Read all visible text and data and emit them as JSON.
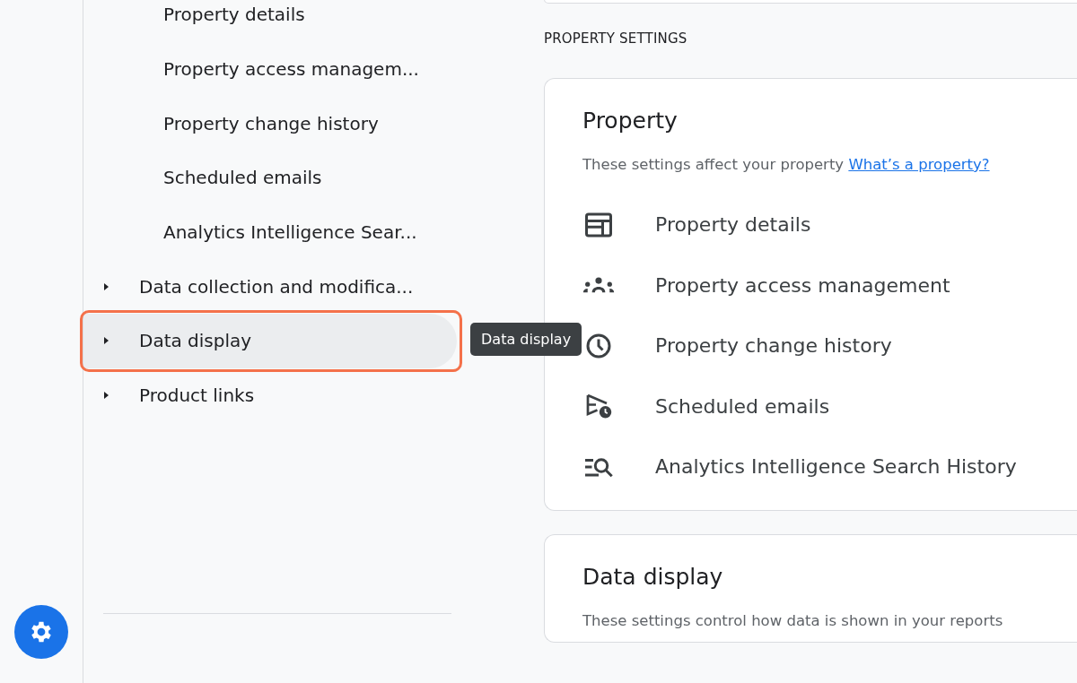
{
  "nav": {
    "items": [
      {
        "label": "Property details",
        "kind": "sub",
        "selected": false
      },
      {
        "label": "Property access managem...",
        "kind": "sub",
        "selected": false
      },
      {
        "label": "Property change history",
        "kind": "sub",
        "selected": false
      },
      {
        "label": "Scheduled emails",
        "kind": "sub",
        "selected": false
      },
      {
        "label": "Analytics Intelligence Sear...",
        "kind": "sub",
        "selected": false
      },
      {
        "label": "Data collection and modifica...",
        "kind": "group",
        "expanded": false,
        "selected": false,
        "highlighted": false
      },
      {
        "label": "Data display",
        "kind": "group",
        "expanded": false,
        "selected": true,
        "highlighted": true
      },
      {
        "label": "Product links",
        "kind": "group",
        "expanded": false,
        "selected": false,
        "highlighted": false
      }
    ]
  },
  "tooltip": {
    "text": "Data display"
  },
  "section_heading": "PROPERTY SETTINGS",
  "cards": [
    {
      "title": "Property",
      "description": "These settings affect your property",
      "link": "What’s a property?",
      "rows": [
        {
          "kind": "details",
          "label": "Property details"
        },
        {
          "kind": "people",
          "label": "Property access management"
        },
        {
          "kind": "history",
          "label": "Property change history"
        },
        {
          "kind": "schedule",
          "label": "Scheduled emails"
        },
        {
          "kind": "search",
          "label": "Analytics Intelligence Search History"
        }
      ]
    },
    {
      "title": "Data display",
      "description": "These settings control how data is shown in your reports"
    }
  ]
}
